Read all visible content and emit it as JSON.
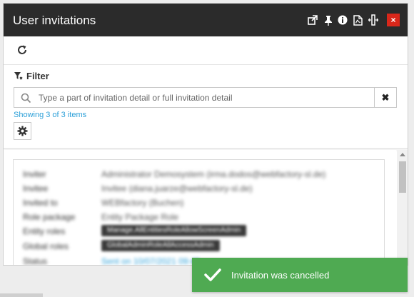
{
  "dialog": {
    "title": "User invitations",
    "toolbar_icons": [
      "open-external-icon",
      "pin-icon",
      "info-icon",
      "pdf-icon",
      "resize-width-icon",
      "close-icon"
    ],
    "close_label": "×",
    "close_color": "#d9271a"
  },
  "filter": {
    "label": "Filter",
    "search_placeholder": "Type a part of invitation detail or full invitation detail",
    "search_value": "",
    "clear_label": "✖",
    "showing_text": "Showing 3 of 3 items"
  },
  "invitation": {
    "rows": [
      {
        "key": "Inviter",
        "value": "Administrator Demosystem (irma.dodos@webfactory-sl.de)",
        "kind": "text"
      },
      {
        "key": "Invitee",
        "value": "Invitee (diana.juarze@webfactory-sl.de)",
        "kind": "text"
      },
      {
        "key": "Invited to",
        "value": "WEBfactory (Buchen)",
        "kind": "text"
      },
      {
        "key": "Role package",
        "value": "Entity Package Role",
        "kind": "text"
      },
      {
        "key": "Entity roles",
        "value": "Manage.AllEntitiesRoleAllowScreenAdmin",
        "kind": "pill"
      },
      {
        "key": "Global roles",
        "value": "GlobalAdminRoleAllAccessAdmin",
        "kind": "pill"
      },
      {
        "key": "Status",
        "value": "Sent on 10/07/2021 09:45",
        "kind": "link"
      }
    ]
  },
  "toast": {
    "message": "Invitation was cancelled",
    "color": "#4faa52"
  }
}
